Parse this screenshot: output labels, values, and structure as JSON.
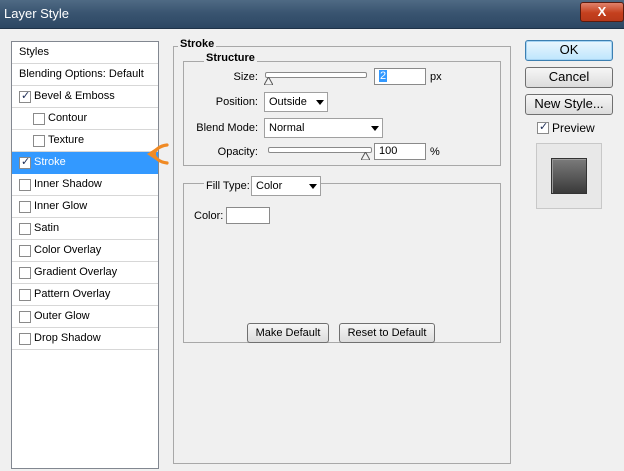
{
  "window": {
    "title": "Layer Style",
    "close_glyph": "X"
  },
  "styles_list": {
    "header": "Styles",
    "blending_options": "Blending Options: Default",
    "items": [
      {
        "label": "Bevel & Emboss",
        "checked": true
      },
      {
        "label": "Contour",
        "checked": false
      },
      {
        "label": "Texture",
        "checked": false
      },
      {
        "label": "Stroke",
        "checked": true
      },
      {
        "label": "Inner Shadow",
        "checked": false
      },
      {
        "label": "Inner Glow",
        "checked": false
      },
      {
        "label": "Satin",
        "checked": false
      },
      {
        "label": "Color Overlay",
        "checked": false
      },
      {
        "label": "Gradient Overlay",
        "checked": false
      },
      {
        "label": "Pattern Overlay",
        "checked": false
      },
      {
        "label": "Outer Glow",
        "checked": false
      },
      {
        "label": "Drop Shadow",
        "checked": false
      }
    ]
  },
  "stroke": {
    "section_title": "Stroke",
    "structure_title": "Structure",
    "size_label": "Size:",
    "size_value": "2",
    "size_unit": "px",
    "size_slider_value": 0.02,
    "position_label": "Position:",
    "position_value": "Outside",
    "blend_mode_label": "Blend Mode:",
    "blend_mode_value": "Normal",
    "opacity_label": "Opacity:",
    "opacity_value": "100",
    "opacity_unit": "%",
    "opacity_slider_value": 1.0,
    "fill_type_label": "Fill Type:",
    "fill_type_value": "Color",
    "color_label": "Color:",
    "color_value": "#ffffff",
    "make_default": "Make Default",
    "reset_to_default": "Reset to Default"
  },
  "actions": {
    "ok": "OK",
    "cancel": "Cancel",
    "new_style": "New Style...",
    "preview_label": "Preview",
    "preview_checked": true
  },
  "colors": {
    "selection": "#3399ff",
    "arrow": "#f08a24"
  }
}
